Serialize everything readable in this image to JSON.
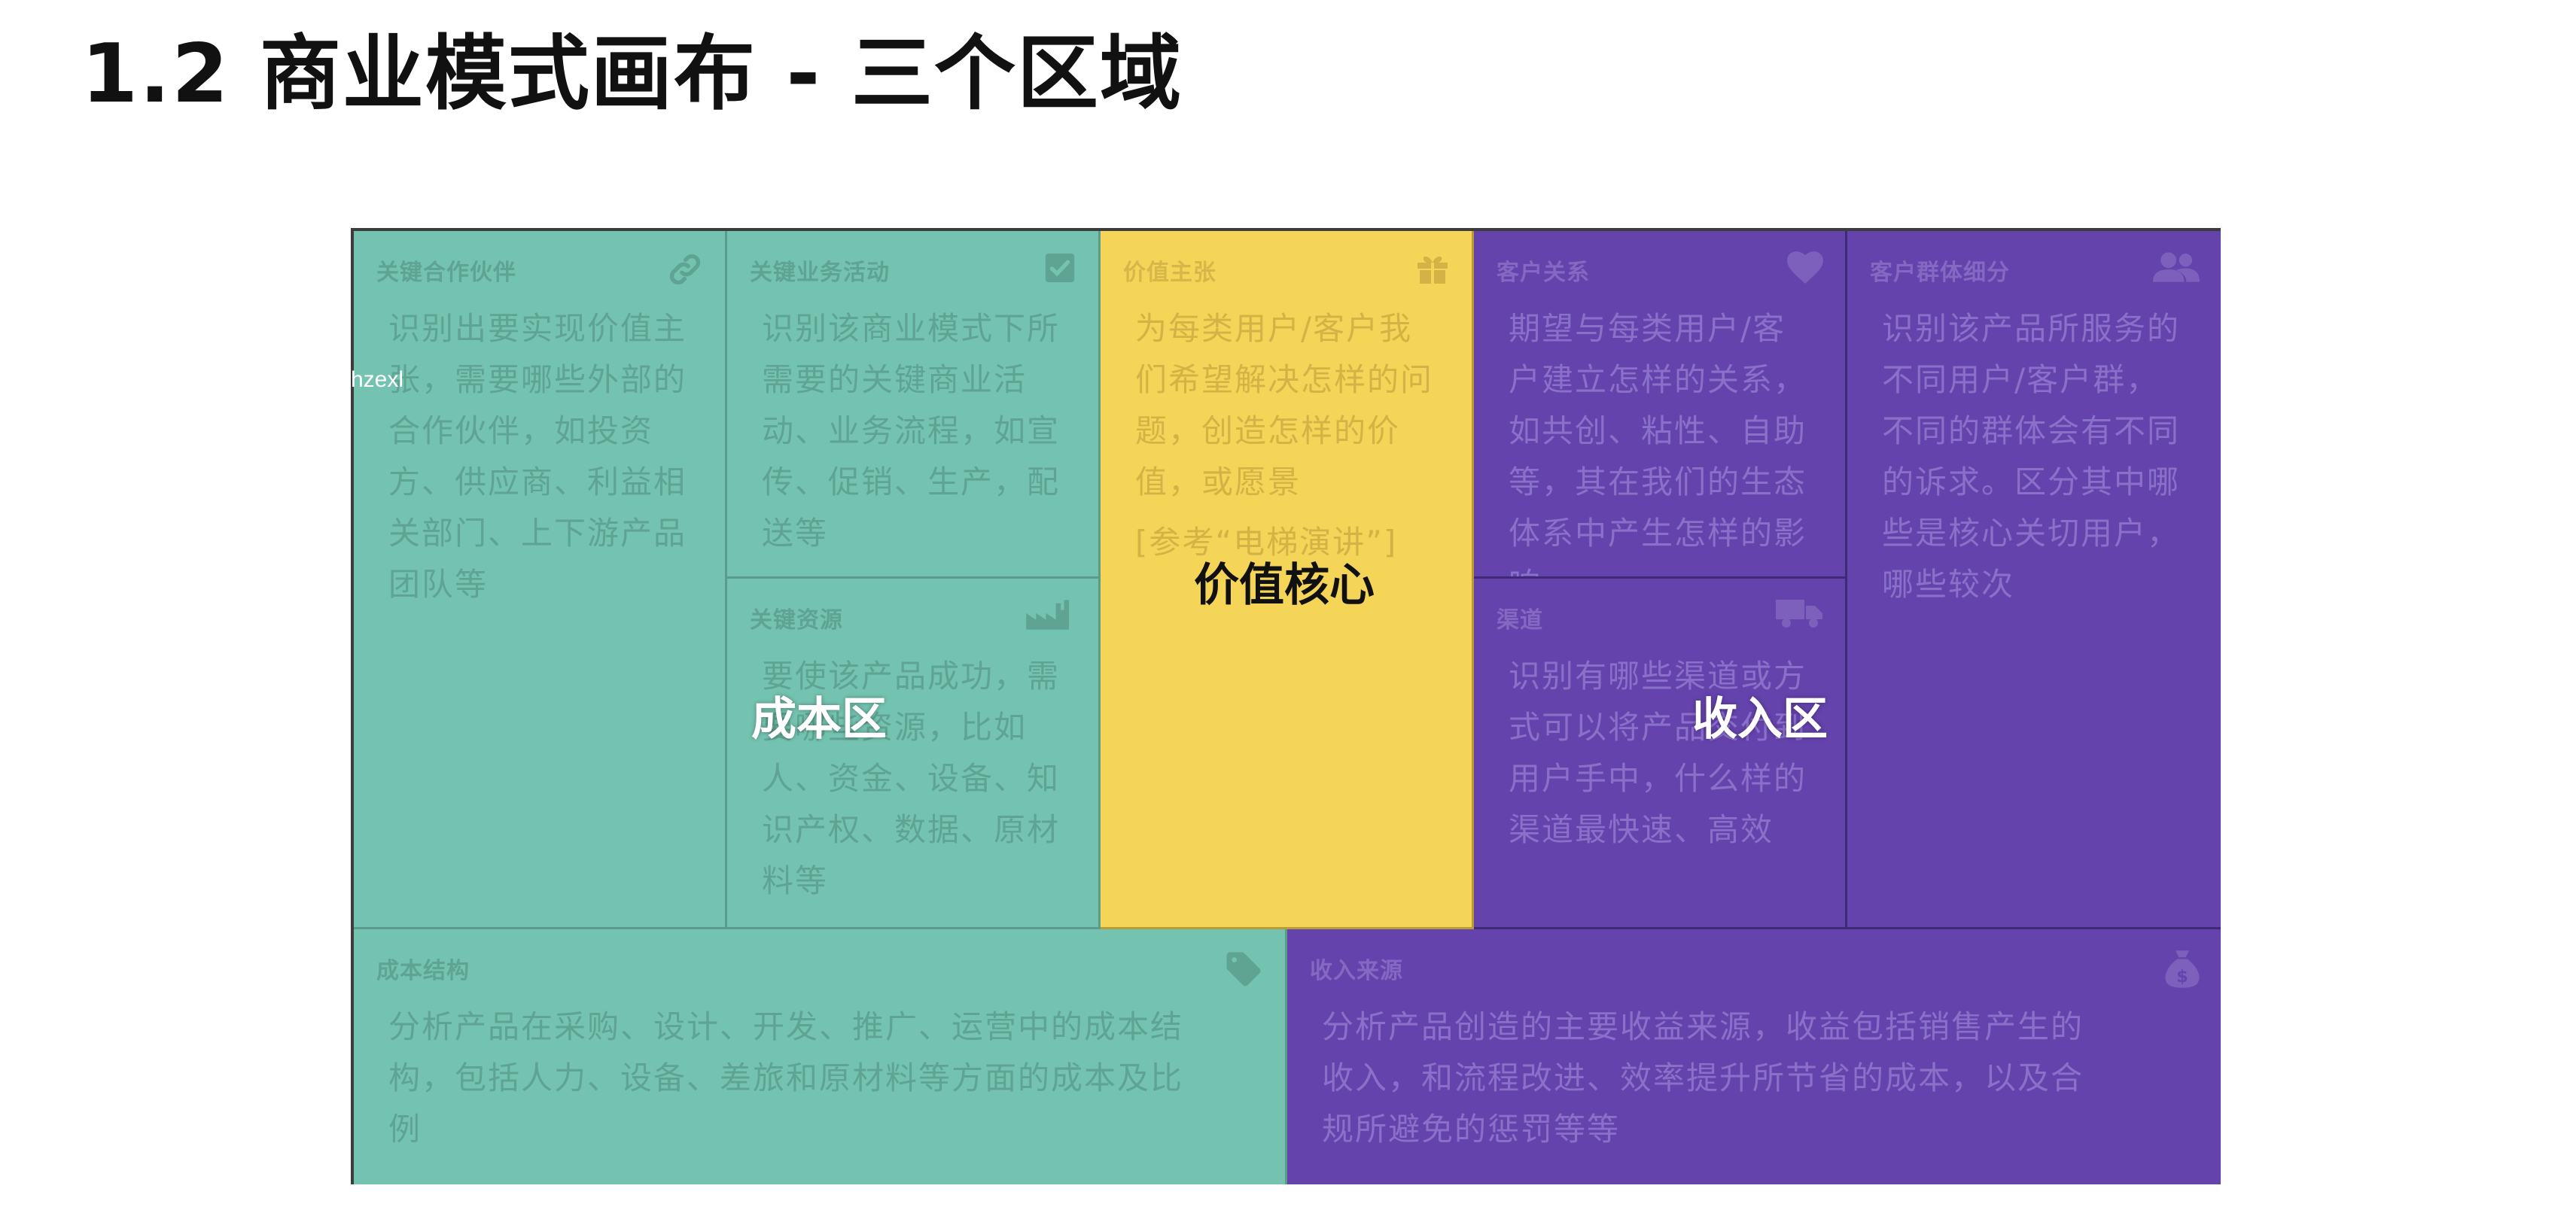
{
  "title": "1.2 商业模式画布 - 三个区域",
  "watermark": "hzexl",
  "colors": {
    "cost_zone": "#74c3b0",
    "value_zone": "#f5d557",
    "revenue_zone": "#6443ad"
  },
  "zones": {
    "cost": "成本区",
    "value": "价值核心",
    "revenue": "收入区"
  },
  "blocks": {
    "key_partners": {
      "title": "关键合作伙伴",
      "icon": "link-icon",
      "desc": "识别出要实现价值主张，需要哪些外部的合作伙伴，如投资方、供应商、利益相关部门、上下游产品团队等"
    },
    "key_activities": {
      "title": "关键业务活动",
      "icon": "checkbox-icon",
      "desc": "识别该商业模式下所需要的关键商业活动、业务流程，如宣传、促销、生产，配送等"
    },
    "key_resources": {
      "title": "关键资源",
      "icon": "factory-icon",
      "desc": "要使该产品成功，需要哪些资源，比如人、资金、设备、知识产权、数据、原材料等"
    },
    "value_propositions": {
      "title": "价值主张",
      "icon": "gift-icon",
      "desc": "为每类用户/客户我们希望解决怎样的问题，创造怎样的价值，或愿景",
      "ref": "[参考“电梯演讲”]"
    },
    "customer_relationships": {
      "title": "客户关系",
      "icon": "heart-icon",
      "desc": "期望与每类用户/客户建立怎样的关系，如共创、粘性、自助等，其在我们的生态体系中产生怎样的影响"
    },
    "channels": {
      "title": "渠道",
      "icon": "truck-icon",
      "desc": "识别有哪些渠道或方式可以将产品交付到用户手中，什么样的渠道最快速、高效"
    },
    "customer_segments": {
      "title": "客户群体细分",
      "icon": "users-icon",
      "desc": "识别该产品所服务的不同用户/客户群，不同的群体会有不同的诉求。区分其中哪些是核心关切用户，哪些较次"
    },
    "cost_structure": {
      "title": "成本结构",
      "icon": "tag-icon",
      "desc": "分析产品在采购、设计、开发、推广、运营中的成本结构，包括人力、设备、差旅和原材料等方面的成本及比例"
    },
    "revenue_streams": {
      "title": "收入来源",
      "icon": "money-bag-icon",
      "desc": "分析产品创造的主要收益来源，收益包括销售产生的收入，和流程改进、效率提升所节省的成本，以及合规所避免的惩罚等等"
    }
  }
}
